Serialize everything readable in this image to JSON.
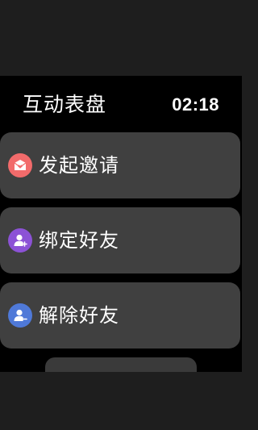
{
  "header": {
    "title": "互动表盘",
    "time": "02:18"
  },
  "menu": {
    "items": [
      {
        "label": "发起邀请",
        "icon": "envelope-heart-icon",
        "color": "#f26b6b"
      },
      {
        "label": "绑定好友",
        "icon": "add-friend-icon",
        "color": "#8c52d6"
      },
      {
        "label": "解除好友",
        "icon": "remove-friend-icon",
        "color": "#4f79d8"
      }
    ]
  },
  "colors": {
    "background": "#000000",
    "frame": "#1e1e1e",
    "card": "#404040",
    "text": "#ffffff"
  }
}
